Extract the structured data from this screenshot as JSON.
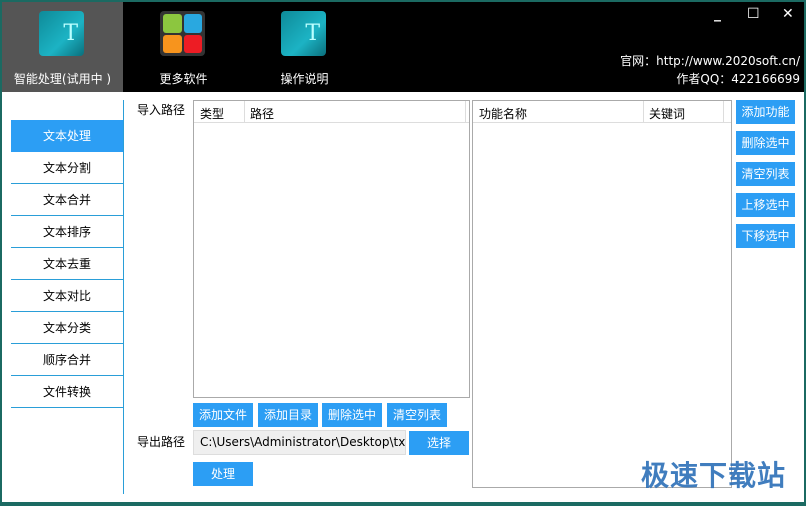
{
  "header": {
    "tabs": [
      {
        "label": "智能处理(试用中 )",
        "icon": "app-statue-icon",
        "selected": true
      },
      {
        "label": "更多软件",
        "icon": "windows-tiles-icon"
      },
      {
        "label": "操作说明",
        "icon": "app-statue-icon"
      }
    ],
    "site": "官网：http://www.2020soft.cn/",
    "qq": "作者QQ：422166699"
  },
  "sidebar": {
    "items": [
      "文本处理",
      "文本分割",
      "文本合并",
      "文本排序",
      "文本去重",
      "文本对比",
      "文本分类",
      "顺序合并",
      "文件转换"
    ],
    "selected": 0
  },
  "import": {
    "label": "导入路径",
    "columns": [
      "类型",
      "路径"
    ],
    "buttons": [
      "添加文件",
      "添加目录",
      "删除选中",
      "清空列表"
    ]
  },
  "export": {
    "label": "导出路径",
    "value": "C:\\Users\\Administrator\\Desktop\\txtd",
    "select": "选择",
    "process": "处理"
  },
  "functions": {
    "columns": [
      "功能名称",
      "关键词"
    ],
    "buttons": [
      "添加功能",
      "删除选中",
      "清空列表",
      "上移选中",
      "下移选中"
    ]
  },
  "watermark": "极速下载站",
  "colors": {
    "accent": "#2c9ef4",
    "header": "#000000",
    "border": "#1b6a62"
  }
}
